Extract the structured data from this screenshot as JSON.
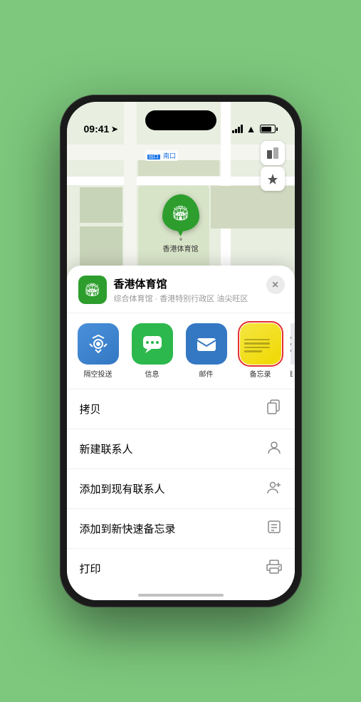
{
  "status": {
    "time": "09:41",
    "time_arrow": "▶",
    "signal": "signal",
    "wifi": "wifi",
    "battery": "battery"
  },
  "map": {
    "label": "南口",
    "location_name": "香港体育馆",
    "pin_label": "香港体育馆"
  },
  "location_panel": {
    "name": "香港体育馆",
    "description": "综合体育馆 · 香港特别行政区 油尖旺区",
    "close_label": "✕"
  },
  "share_items": [
    {
      "id": "airdrop",
      "label": "隔空投送",
      "type": "airdrop"
    },
    {
      "id": "messages",
      "label": "信息",
      "type": "messages"
    },
    {
      "id": "mail",
      "label": "邮件",
      "type": "mail"
    },
    {
      "id": "notes",
      "label": "备忘录",
      "type": "notes"
    },
    {
      "id": "more",
      "label": "推",
      "type": "partial"
    }
  ],
  "actions": [
    {
      "id": "copy",
      "label": "拷贝",
      "icon": "copy"
    },
    {
      "id": "new-contact",
      "label": "新建联系人",
      "icon": "person"
    },
    {
      "id": "add-existing",
      "label": "添加到现有联系人",
      "icon": "person-add"
    },
    {
      "id": "add-notes",
      "label": "添加到新快速备忘录",
      "icon": "notes"
    },
    {
      "id": "print",
      "label": "打印",
      "icon": "print"
    }
  ],
  "colors": {
    "green": "#2d9e2d",
    "blue": "#3478c4",
    "red": "#e63030",
    "yellow": "#f0d800"
  }
}
